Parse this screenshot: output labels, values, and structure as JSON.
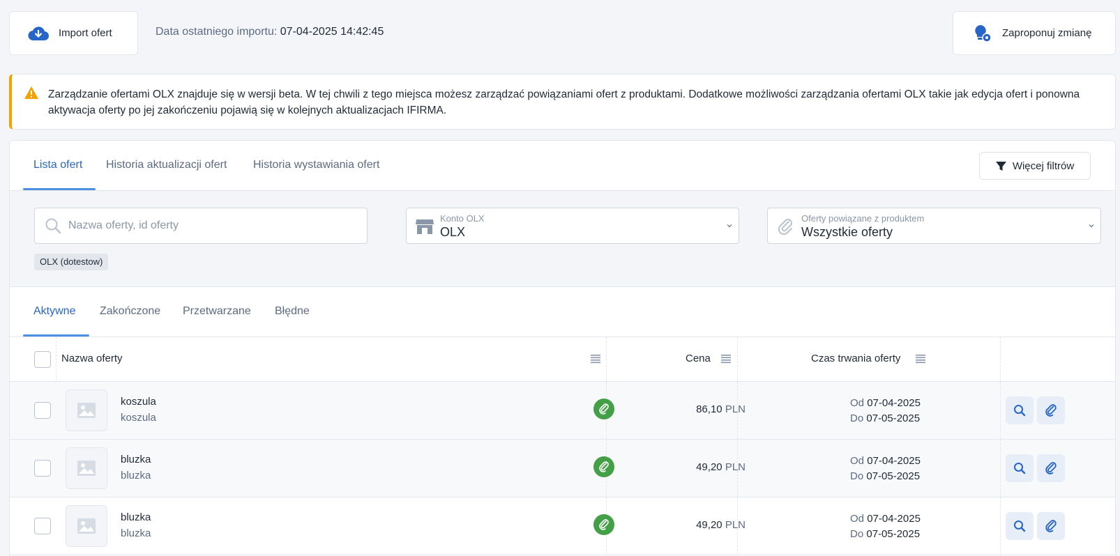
{
  "topbar": {
    "import_label": "Import ofert",
    "last_import_label": "Data ostatniego importu:",
    "last_import_value": "07-04-2025 14:42:45",
    "suggest_label": "Zaproponuj zmianę"
  },
  "alert": {
    "text": "Zarządzanie ofertami OLX znajduje się w wersji beta. W tej chwili z tego miejsca możesz zarządzać powiązaniami ofert z produktami. Dodatkowe możliwości zarządzania ofertami OLX takie jak edycja ofert i ponowna aktywacja oferty po jej zakończeniu pojawią się w kolejnych aktualizacjach IFIRMA."
  },
  "tabs": {
    "main": [
      {
        "label": "Lista ofert",
        "active": true
      },
      {
        "label": "Historia aktualizacji ofert",
        "active": false
      },
      {
        "label": "Historia wystawiania ofert",
        "active": false
      }
    ],
    "more_filters_label": "Więcej filtrów",
    "status": [
      {
        "label": "Aktywne",
        "active": true
      },
      {
        "label": "Zakończone",
        "active": false
      },
      {
        "label": "Przetwarzane",
        "active": false
      },
      {
        "label": "Błędne",
        "active": false
      }
    ]
  },
  "filters": {
    "search_placeholder": "Nazwa oferty, id oferty",
    "account_label": "Konto OLX",
    "account_value": "OLX",
    "linked_label": "Oferty powiązane z produktem",
    "linked_value": "Wszystkie oferty",
    "chip": "OLX (dotestow)"
  },
  "table": {
    "headers": {
      "name": "Nazwa oferty",
      "price": "Cena",
      "duration": "Czas trwania oferty"
    },
    "rows": [
      {
        "name": "koszula",
        "sub": "koszula",
        "price": "86,10",
        "currency": "PLN",
        "from_label": "Od",
        "from": "07-04-2025",
        "to_label": "Do",
        "to": "07-05-2025"
      },
      {
        "name": "bluzka",
        "sub": "bluzka",
        "price": "49,20",
        "currency": "PLN",
        "from_label": "Od",
        "from": "07-04-2025",
        "to_label": "Do",
        "to": "07-05-2025"
      },
      {
        "name": "bluzka",
        "sub": "bluzka",
        "price": "49,20",
        "currency": "PLN",
        "from_label": "Od",
        "from": "07-04-2025",
        "to_label": "Do",
        "to": "07-05-2025"
      }
    ]
  },
  "colors": {
    "accent": "#2766c7",
    "warning": "#f5a200",
    "linked_green": "#43a047"
  }
}
